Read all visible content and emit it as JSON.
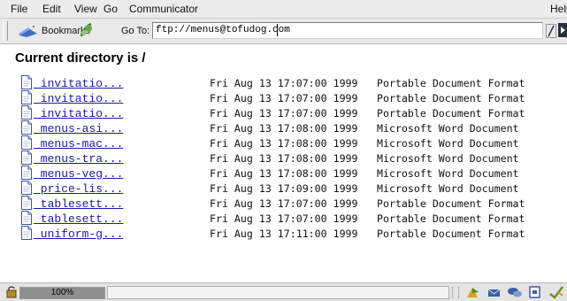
{
  "menubar": {
    "items": [
      "File",
      "Edit",
      "View",
      "Go",
      "Communicator",
      "Help"
    ]
  },
  "toolbar": {
    "bookmarks_label": "Bookmarks",
    "goto_label": "Go To:",
    "location_value": "ftp://menus@tofudog.com"
  },
  "page": {
    "title": "Current directory is /"
  },
  "files": [
    {
      "name": "invitatio...",
      "date": "Fri Aug 13 17:07:00 1999",
      "type": "Portable Document Format"
    },
    {
      "name": "invitatio...",
      "date": "Fri Aug 13 17:07:00 1999",
      "type": "Portable Document Format"
    },
    {
      "name": "invitatio...",
      "date": "Fri Aug 13 17:07:00 1999",
      "type": "Portable Document Format"
    },
    {
      "name": "menus-asi...",
      "date": "Fri Aug 13 17:08:00 1999",
      "type": "Microsoft Word Document"
    },
    {
      "name": "menus-mac...",
      "date": "Fri Aug 13 17:08:00 1999",
      "type": "Microsoft Word Document"
    },
    {
      "name": "menus-tra...",
      "date": "Fri Aug 13 17:08:00 1999",
      "type": "Microsoft Word Document"
    },
    {
      "name": "menus-veg...",
      "date": "Fri Aug 13 17:08:00 1999",
      "type": "Microsoft Word Document"
    },
    {
      "name": "price-lis...",
      "date": "Fri Aug 13 17:09:00 1999",
      "type": "Microsoft Word Document"
    },
    {
      "name": "tablesett...",
      "date": "Fri Aug 13 17:07:00 1999",
      "type": "Portable Document Format"
    },
    {
      "name": "tablesett...",
      "date": "Fri Aug 13 17:07:00 1999",
      "type": "Portable Document Format"
    },
    {
      "name": "uniform-g...",
      "date": "Fri Aug 13 17:11:00 1999",
      "type": "Portable Document Format"
    }
  ],
  "statusbar": {
    "progress_label": "100%",
    "progress_fraction": 1.0,
    "component_icons": [
      "navigator-icon",
      "mail-icon",
      "discussion-icon",
      "composer-icon",
      "conference-icon"
    ]
  },
  "colors": {
    "link": "#1a1aa6",
    "chrome": "#ececec"
  }
}
